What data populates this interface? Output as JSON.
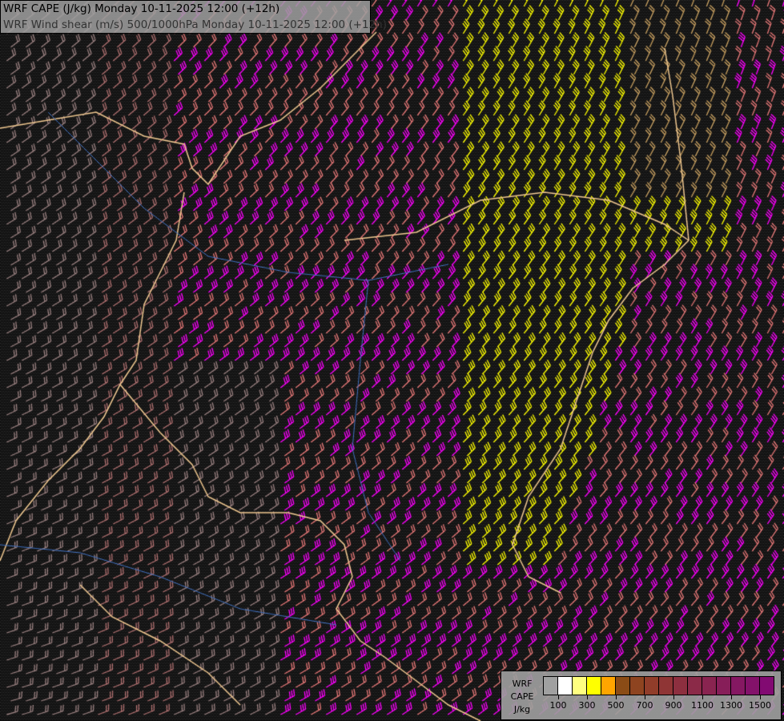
{
  "title": {
    "line1": "WRF CAPE (J/kg) Monday 10-11-2025 12:00 (+12h)",
    "line2": "WRF Wind shear (m/s) 500/1000hPa Monday 10-11-2025 12:00 (+12h)"
  },
  "legend": {
    "label_lines": [
      "WRF",
      "CAPE",
      "J/kg"
    ],
    "colors": [
      "#a0a0a0",
      "#ffffff",
      "#ffff80",
      "#ffff00",
      "#ffa500",
      "#8b4c16",
      "#8e4420",
      "#913d2a",
      "#8f3535",
      "#8d2f3f",
      "#8b2a48",
      "#892450",
      "#871e59",
      "#851862",
      "#83126a",
      "#820a72"
    ],
    "ticks": [
      "100",
      "300",
      "500",
      "700",
      "900",
      "1100",
      "1300",
      "1500"
    ]
  },
  "map": {
    "barb_colors": {
      "magenta": "#ff00ff",
      "salmon": "#e87878",
      "yellow": "#ffff00",
      "tan": "#c8a060",
      "grey": "#9a8080",
      "brown": "#b07070"
    },
    "border_color": "#f0c890",
    "river_color": "#4070c0"
  }
}
